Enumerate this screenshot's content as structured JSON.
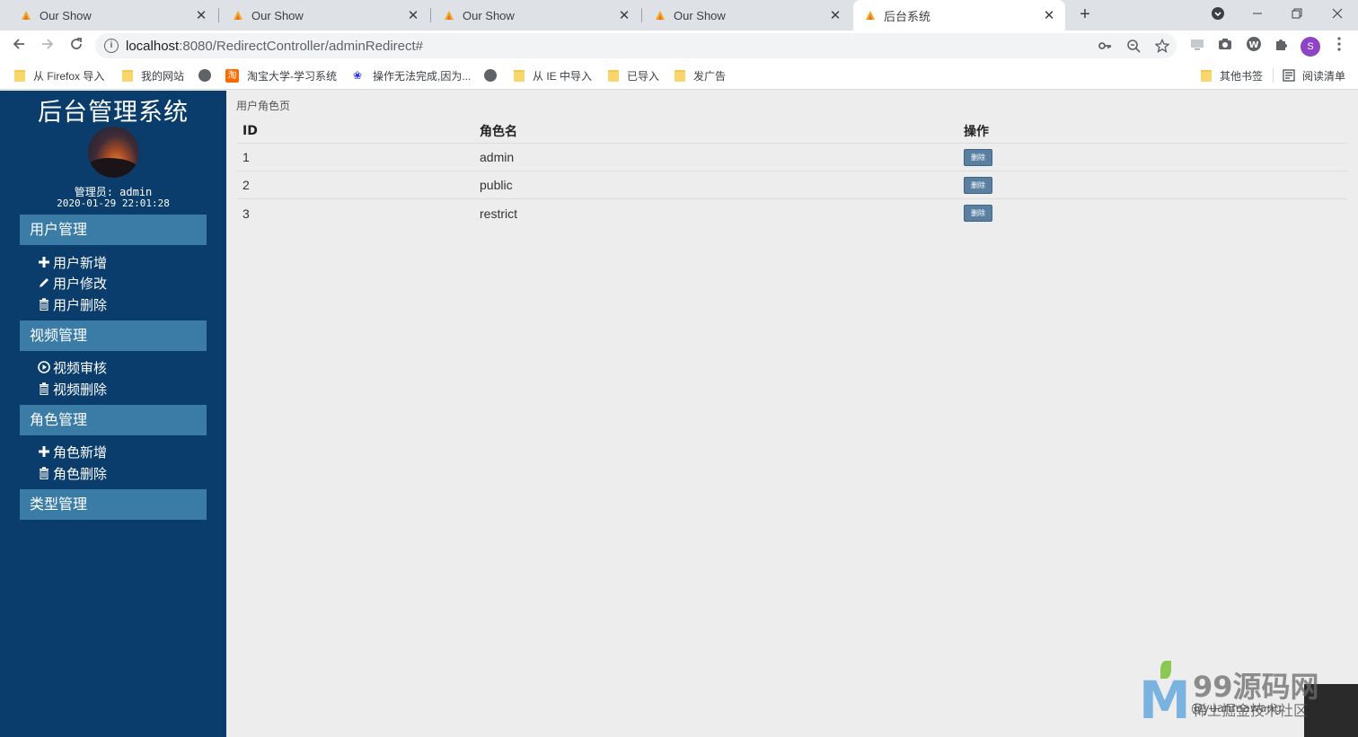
{
  "browser": {
    "tabs": [
      {
        "title": "Our Show",
        "active": false
      },
      {
        "title": "Our Show",
        "active": false
      },
      {
        "title": "Our Show",
        "active": false
      },
      {
        "title": "Our Show",
        "active": false
      },
      {
        "title": "后台系统",
        "active": true
      }
    ],
    "url_host": "localhost",
    "url_rest": ":8080/RedirectController/adminRedirect#",
    "profile_initial": "S",
    "bookmarks": [
      "从 Firefox 导入",
      "我的网站",
      "淘宝大学-学习系统",
      "操作无法完成,因为...",
      "从 IE 中导入",
      "已导入",
      "发广告"
    ],
    "bookmarks_right": [
      "其他书签",
      "阅读清单"
    ]
  },
  "sidebar": {
    "title": "后台管理系统",
    "admin_label": "管理员: admin",
    "timestamp": "2020-01-29 22:01:28",
    "groups": [
      {
        "label": "用户管理",
        "items": [
          {
            "label": "用户新增",
            "icon": "plus-icon"
          },
          {
            "label": "用户修改",
            "icon": "pencil-icon"
          },
          {
            "label": "用户删除",
            "icon": "trash-icon"
          }
        ]
      },
      {
        "label": "视频管理",
        "items": [
          {
            "label": "视频审核",
            "icon": "play-circle-icon"
          },
          {
            "label": "视频删除",
            "icon": "trash-icon"
          }
        ]
      },
      {
        "label": "角色管理",
        "items": [
          {
            "label": "角色新增",
            "icon": "plus-icon"
          },
          {
            "label": "角色删除",
            "icon": "trash-icon"
          }
        ]
      },
      {
        "label": "类型管理",
        "items": []
      }
    ]
  },
  "main": {
    "breadcrumb": "用户角色页",
    "columns": [
      "ID",
      "角色名",
      "操作"
    ],
    "rows": [
      {
        "id": "1",
        "name": "admin",
        "action": "删除"
      },
      {
        "id": "2",
        "name": "public",
        "action": "删除"
      },
      {
        "id": "3",
        "name": "restrict",
        "action": "删除"
      }
    ]
  },
  "watermark": {
    "brand": "99源码网",
    "sub": "稀土掘金技术社区",
    "site": "@yuanmawang"
  },
  "colors": {
    "sidebar_bg": "#0a3d6b",
    "menu_head_bg": "#3a7ca6",
    "delete_button_bg": "#5a7fa0",
    "page_bg": "#ededed"
  }
}
